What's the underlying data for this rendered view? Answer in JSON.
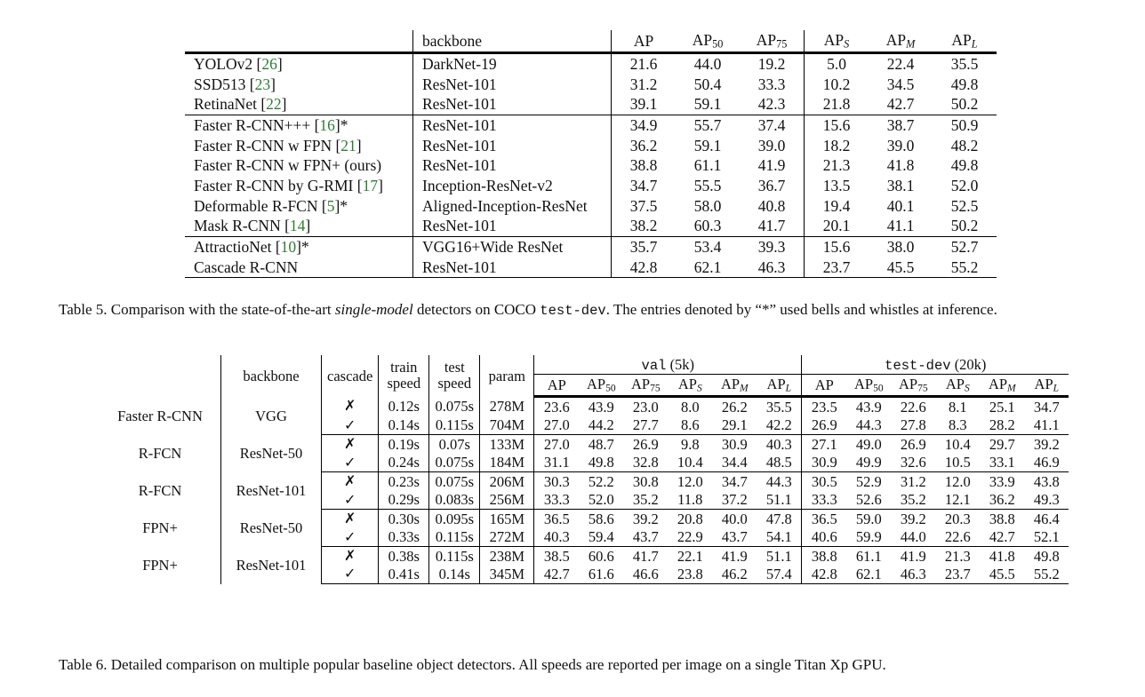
{
  "table5": {
    "name": "table-5",
    "columns": [
      "",
      "backbone",
      "AP",
      "AP50",
      "AP75",
      "APS",
      "APM",
      "APL"
    ],
    "headers": {
      "method": "",
      "backbone": "backbone",
      "ap": "AP",
      "ap50_base": "AP",
      "ap50_sub": "50",
      "ap75_base": "AP",
      "ap75_sub": "75",
      "aps_base": "AP",
      "aps_sub": "S",
      "apm_base": "AP",
      "apm_sub": "M",
      "apl_base": "AP",
      "apl_sub": "L"
    },
    "groups": [
      {
        "rows": [
          {
            "method": "YOLOv2",
            "cite": "[26]",
            "star": "",
            "backbone": "DarkNet-19",
            "ap": "21.6",
            "ap50": "44.0",
            "ap75": "19.2",
            "aps": "5.0",
            "apm": "22.4",
            "apl": "35.5",
            "bold": false
          },
          {
            "method": "SSD513",
            "cite": "[23]",
            "star": "",
            "backbone": "ResNet-101",
            "ap": "31.2",
            "ap50": "50.4",
            "ap75": "33.3",
            "aps": "10.2",
            "apm": "34.5",
            "apl": "49.8",
            "bold": false
          },
          {
            "method": "RetinaNet",
            "cite": "[22]",
            "star": "",
            "backbone": "ResNet-101",
            "ap": "39.1",
            "ap50": "59.1",
            "ap75": "42.3",
            "aps": "21.8",
            "apm": "42.7",
            "apl": "50.2",
            "bold": false
          }
        ]
      },
      {
        "rows": [
          {
            "method": "Faster R-CNN+++",
            "cite": "[16]",
            "star": "*",
            "backbone": "ResNet-101",
            "ap": "34.9",
            "ap50": "55.7",
            "ap75": "37.4",
            "aps": "15.6",
            "apm": "38.7",
            "apl": "50.9",
            "bold": false
          },
          {
            "method": "Faster R-CNN w FPN",
            "cite": "[21]",
            "star": "",
            "backbone": "ResNet-101",
            "ap": "36.2",
            "ap50": "59.1",
            "ap75": "39.0",
            "aps": "18.2",
            "apm": "39.0",
            "apl": "48.2",
            "bold": false
          },
          {
            "method": "Faster R-CNN w FPN+ (ours)",
            "cite": "",
            "star": "",
            "backbone": "ResNet-101",
            "ap": "38.8",
            "ap50": "61.1",
            "ap75": "41.9",
            "aps": "21.3",
            "apm": "41.8",
            "apl": "49.8",
            "bold": false
          },
          {
            "method": "Faster R-CNN by G-RMI",
            "cite": "[17]",
            "star": "",
            "backbone": "Inception-ResNet-v2",
            "ap": "34.7",
            "ap50": "55.5",
            "ap75": "36.7",
            "aps": "13.5",
            "apm": "38.1",
            "apl": "52.0",
            "bold": false
          },
          {
            "method": "Deformable R-FCN",
            "cite": "[5]",
            "star": "*",
            "backbone": "Aligned-Inception-ResNet",
            "ap": "37.5",
            "ap50": "58.0",
            "ap75": "40.8",
            "aps": "19.4",
            "apm": "40.1",
            "apl": "52.5",
            "bold": false
          },
          {
            "method": "Mask R-CNN",
            "cite": "[14]",
            "star": "",
            "backbone": "ResNet-101",
            "ap": "38.2",
            "ap50": "60.3",
            "ap75": "41.7",
            "aps": "20.1",
            "apm": "41.1",
            "apl": "50.2",
            "bold": false
          }
        ]
      },
      {
        "rows": [
          {
            "method": "AttractioNet",
            "cite": "[10]",
            "star": "*",
            "backbone": "VGG16+Wide ResNet",
            "ap": "35.7",
            "ap50": "53.4",
            "ap75": "39.3",
            "aps": "15.6",
            "apm": "38.0",
            "apl": "52.7",
            "bold": false
          },
          {
            "method": "Cascade R-CNN",
            "cite": "",
            "star": "",
            "backbone": "ResNet-101",
            "ap": "42.8",
            "ap50": "62.1",
            "ap75": "46.3",
            "aps": "23.7",
            "apm": "45.5",
            "apl": "55.2",
            "bold": true
          }
        ]
      }
    ]
  },
  "caption5": {
    "label": "Table 5.",
    "part1": " Comparison with the state-of-the-art ",
    "italic": "single-model",
    "part2": " detectors on COCO ",
    "mono": "test-dev",
    "part3": ". The entries denoted by “*” used bells and whistles at inference."
  },
  "table6": {
    "name": "table-6",
    "headers": {
      "method": "",
      "backbone": "backbone",
      "cascade": "cascade",
      "train_line1": "train",
      "train_line2": "speed",
      "test_line1": "test",
      "test_line2": "speed",
      "param": "param",
      "val_group_mono": "val",
      "val_group_suffix": " (5k)",
      "testdev_group_mono": "test-dev",
      "testdev_group_suffix": " (20k)",
      "ap": "AP",
      "ap50_base": "AP",
      "ap50_sub": "50",
      "ap75_base": "AP",
      "ap75_sub": "75",
      "aps_base": "AP",
      "aps_sub": "S",
      "apm_base": "AP",
      "apm_sub": "M",
      "apl_base": "AP",
      "apl_sub": "L"
    },
    "marks": {
      "no": "✗",
      "yes": "✓"
    },
    "groups": [
      {
        "method": "Faster R-CNN",
        "backbone": "VGG",
        "rows": [
          {
            "cascade": "no",
            "train_speed": "0.12s",
            "test_speed": "0.075s",
            "param": "278M",
            "val": [
              "23.6",
              "43.9",
              "23.0",
              "8.0",
              "26.2",
              "35.5"
            ],
            "test": [
              "23.5",
              "43.9",
              "22.6",
              "8.1",
              "25.1",
              "34.7"
            ]
          },
          {
            "cascade": "yes",
            "train_speed": "0.14s",
            "test_speed": "0.115s",
            "param": "704M",
            "val": [
              "27.0",
              "44.2",
              "27.7",
              "8.6",
              "29.1",
              "42.2"
            ],
            "test": [
              "26.9",
              "44.3",
              "27.8",
              "8.3",
              "28.2",
              "41.1"
            ]
          }
        ]
      },
      {
        "method": "R-FCN",
        "backbone": "ResNet-50",
        "rows": [
          {
            "cascade": "no",
            "train_speed": "0.19s",
            "test_speed": "0.07s",
            "param": "133M",
            "val": [
              "27.0",
              "48.7",
              "26.9",
              "9.8",
              "30.9",
              "40.3"
            ],
            "test": [
              "27.1",
              "49.0",
              "26.9",
              "10.4",
              "29.7",
              "39.2"
            ]
          },
          {
            "cascade": "yes",
            "train_speed": "0.24s",
            "test_speed": "0.075s",
            "param": "184M",
            "val": [
              "31.1",
              "49.8",
              "32.8",
              "10.4",
              "34.4",
              "48.5"
            ],
            "test": [
              "30.9",
              "49.9",
              "32.6",
              "10.5",
              "33.1",
              "46.9"
            ]
          }
        ]
      },
      {
        "method": "R-FCN",
        "backbone": "ResNet-101",
        "rows": [
          {
            "cascade": "no",
            "train_speed": "0.23s",
            "test_speed": "0.075s",
            "param": "206M",
            "val": [
              "30.3",
              "52.2",
              "30.8",
              "12.0",
              "34.7",
              "44.3"
            ],
            "test": [
              "30.5",
              "52.9",
              "31.2",
              "12.0",
              "33.9",
              "43.8"
            ]
          },
          {
            "cascade": "yes",
            "train_speed": "0.29s",
            "test_speed": "0.083s",
            "param": "256M",
            "val": [
              "33.3",
              "52.0",
              "35.2",
              "11.8",
              "37.2",
              "51.1"
            ],
            "test": [
              "33.3",
              "52.6",
              "35.2",
              "12.1",
              "36.2",
              "49.3"
            ]
          }
        ]
      },
      {
        "method": "FPN+",
        "backbone": "ResNet-50",
        "rows": [
          {
            "cascade": "no",
            "train_speed": "0.30s",
            "test_speed": "0.095s",
            "param": "165M",
            "val": [
              "36.5",
              "58.6",
              "39.2",
              "20.8",
              "40.0",
              "47.8"
            ],
            "test": [
              "36.5",
              "59.0",
              "39.2",
              "20.3",
              "38.8",
              "46.4"
            ]
          },
          {
            "cascade": "yes",
            "train_speed": "0.33s",
            "test_speed": "0.115s",
            "param": "272M",
            "val": [
              "40.3",
              "59.4",
              "43.7",
              "22.9",
              "43.7",
              "54.1"
            ],
            "test": [
              "40.6",
              "59.9",
              "44.0",
              "22.6",
              "42.7",
              "52.1"
            ]
          }
        ]
      },
      {
        "method": "FPN+",
        "backbone": "ResNet-101",
        "rows": [
          {
            "cascade": "no",
            "train_speed": "0.38s",
            "test_speed": "0.115s",
            "param": "238M",
            "val": [
              "38.5",
              "60.6",
              "41.7",
              "22.1",
              "41.9",
              "51.1"
            ],
            "test": [
              "38.8",
              "61.1",
              "41.9",
              "21.3",
              "41.8",
              "49.8"
            ]
          },
          {
            "cascade": "yes",
            "train_speed": "0.41s",
            "test_speed": "0.14s",
            "param": "345M",
            "val": [
              "42.7",
              "61.6",
              "46.6",
              "23.8",
              "46.2",
              "57.4"
            ],
            "test": [
              "42.8",
              "62.1",
              "46.3",
              "23.7",
              "45.5",
              "55.2"
            ]
          }
        ]
      }
    ]
  },
  "caption6": {
    "label": "Table 6.",
    "text": " Detailed comparison on multiple popular baseline object detectors. All speeds are reported per image on a single Titan Xp GPU."
  },
  "colors": {
    "citation_green": "#2f7d32",
    "rule_black": "#000000",
    "text": "#111111"
  }
}
